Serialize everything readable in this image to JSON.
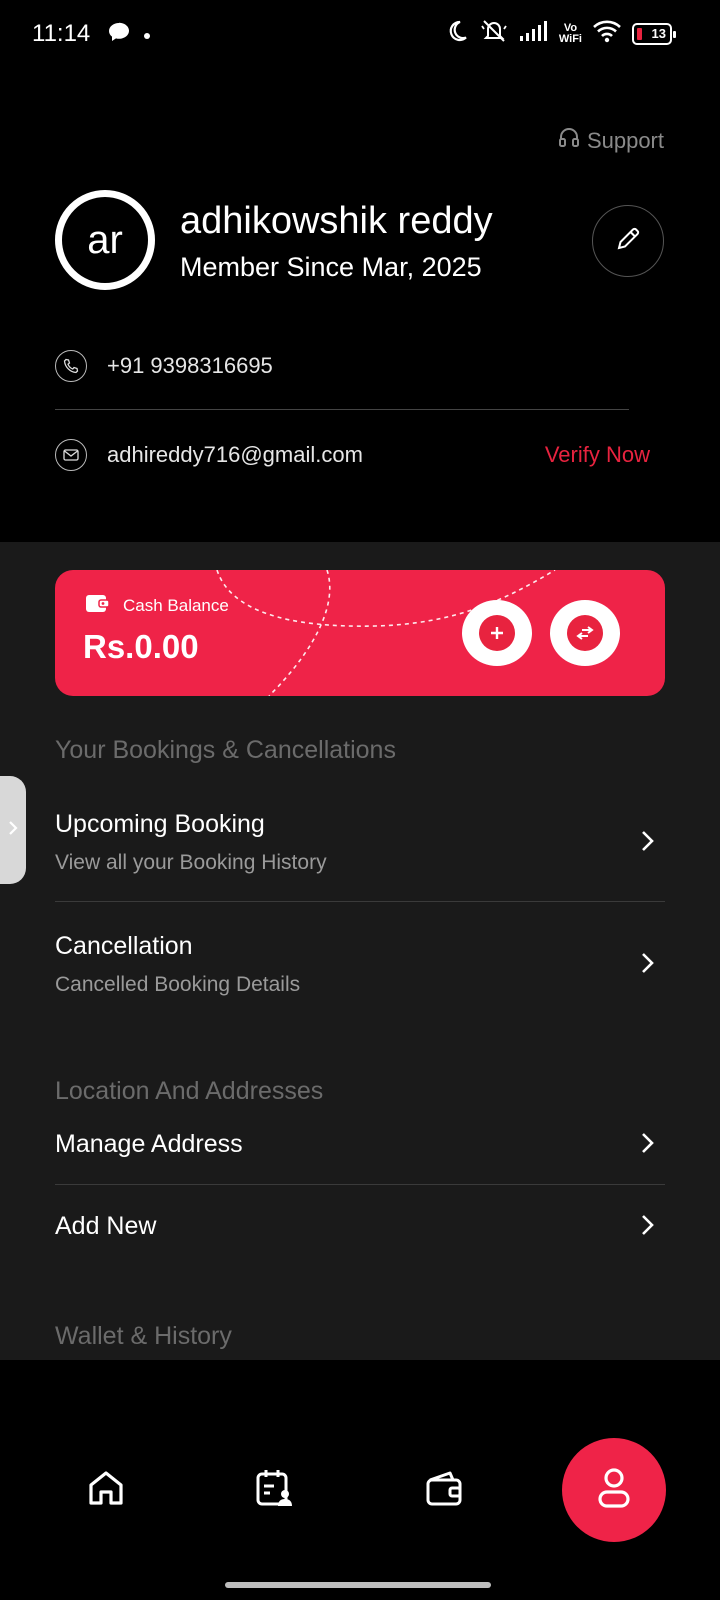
{
  "status_bar": {
    "time": "11:14",
    "vowifi_top": "Vo",
    "vowifi_bottom": "WiFi",
    "battery": "13"
  },
  "profile": {
    "support_label": "Support",
    "avatar_initials": "ar",
    "name": "adhikowshik reddy",
    "member_since": "Member Since Mar, 2025",
    "phone": "+91 9398316695",
    "email": "adhireddy716@gmail.com",
    "verify_label": "Verify Now"
  },
  "wallet_card": {
    "label": "Cash Balance",
    "amount": "Rs.0.00"
  },
  "sections": {
    "bookings": {
      "title": "Your Bookings & Cancellations",
      "items": [
        {
          "title": "Upcoming Booking",
          "subtitle": "View all your Booking History"
        },
        {
          "title": "Cancellation",
          "subtitle": "Cancelled Booking Details"
        }
      ]
    },
    "location": {
      "title": "Location And Addresses",
      "items": [
        {
          "title": "Manage Address"
        },
        {
          "title": "Add New"
        }
      ]
    },
    "wallet": {
      "title": "Wallet & History"
    }
  },
  "bottom_nav": {
    "items": [
      "home-icon",
      "bookings-calendar-icon",
      "wallet-icon",
      "profile-icon"
    ],
    "active": "profile-icon"
  },
  "colors": {
    "accent": "#ef2348",
    "background": "#000000",
    "panel": "#1a1a1a"
  }
}
